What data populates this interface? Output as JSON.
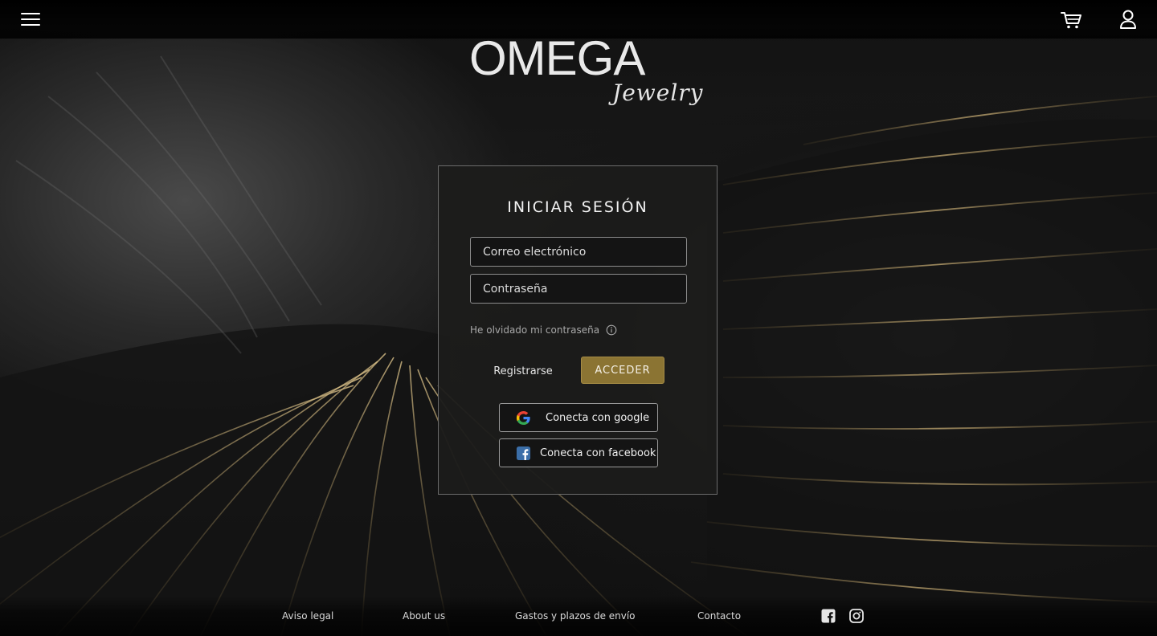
{
  "header": {
    "menu_icon": "hamburger-menu-icon",
    "cart_icon": "shopping-cart-icon",
    "user_icon": "user-account-icon"
  },
  "brand": {
    "name": "OMEGA",
    "tagline": "Jewelry"
  },
  "login": {
    "title": "INICIAR SESIÓN",
    "email_placeholder": "Correo electrónico",
    "password_placeholder": "Contraseña",
    "forgot_password": "He olvidado mi contraseña",
    "register_label": "Registrarse",
    "submit_label": "ACCEDER",
    "google_label": "Conecta con google",
    "facebook_label": "Conecta con facebook"
  },
  "footer": {
    "links": [
      "Aviso legal",
      "About us",
      "Gastos y plazos de envío",
      "Contacto"
    ],
    "social_icons": [
      "facebook-icon",
      "instagram-icon"
    ]
  },
  "colors": {
    "accent": "#8b7433",
    "card_background": "#1c1c1b",
    "facebook_blue": "#3b6ea8"
  }
}
